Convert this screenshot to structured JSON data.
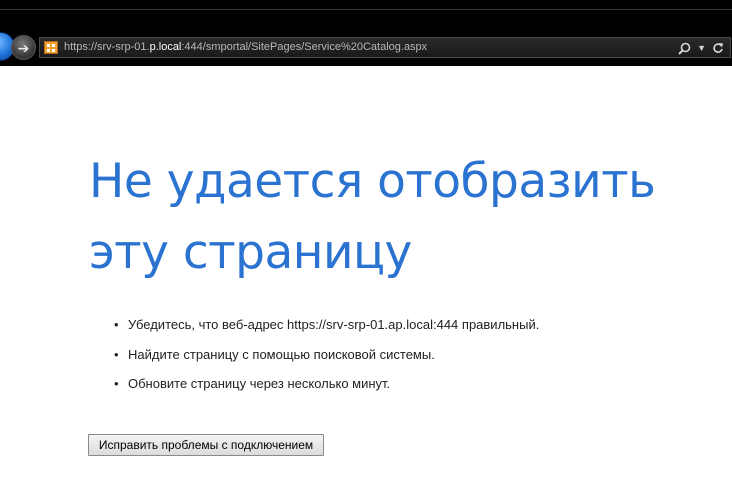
{
  "browser": {
    "address": {
      "url_prefix": "https://srv-srp-01.",
      "url_host_tail": "p.local",
      "url_rest": ":444/smportal/SitePages/Service%20Catalog.aspx"
    },
    "icons": {
      "back": "back-arrow-icon",
      "forward": "forward-arrow-icon",
      "favicon": "site-favicon-icon",
      "search": "search-icon",
      "dropdown": "chevron-down-icon",
      "refresh": "refresh-icon"
    }
  },
  "error": {
    "title": "Не удается отобразить эту страницу",
    "tips": [
      "Убедитесь, что веб-адрес https://srv-srp-01.a",
      "Найдите страницу с помощью поисковой системы.",
      "Обновите страницу через несколько минут."
    ],
    "tip0_tail": "p.local:444 правильный.",
    "bullet": "•",
    "fix_button_label": "Исправить проблемы с подключением"
  },
  "colors": {
    "title": "#2b73d1",
    "chrome": "#000000",
    "page_background": "#ffffff"
  }
}
